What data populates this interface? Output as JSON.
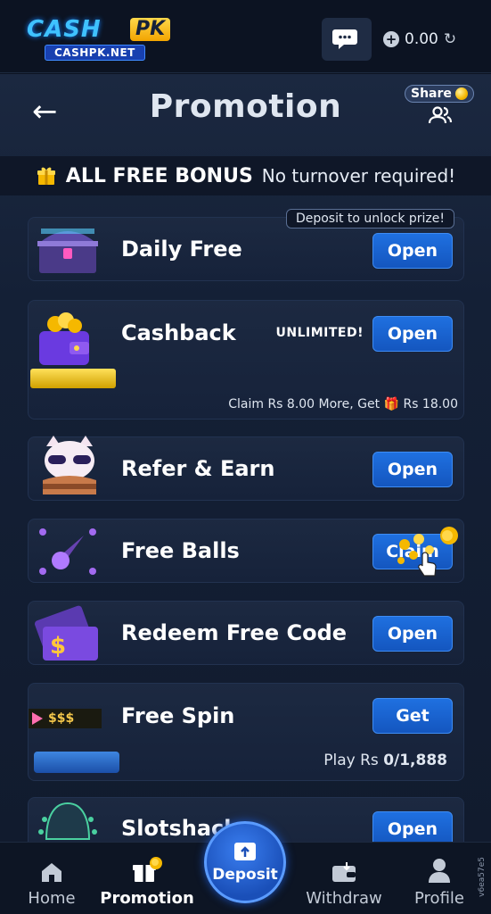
{
  "topbar": {
    "logo_main": "CASH",
    "logo_pk": "PK",
    "logo_sub": "CASHPK.NET",
    "balance": "0.00"
  },
  "header": {
    "title": "Promotion",
    "share_label": "Share"
  },
  "bonus_bar": {
    "strong": "ALL FREE BONUS",
    "weak": "No turnover required!"
  },
  "cards": {
    "daily": {
      "title": "Daily Free",
      "note": "Deposit to unlock prize!",
      "button": "Open"
    },
    "cashback": {
      "title": "Cashback",
      "badge": "UNLIMITED!",
      "button": "Open",
      "claim_text": "Claim Rs 8.00 More, Get",
      "claim_reward": "Rs 18.00"
    },
    "refer": {
      "title": "Refer & Earn",
      "button": "Open"
    },
    "balls": {
      "title": "Free Balls",
      "button": "Claim"
    },
    "redeem": {
      "title": "Redeem Free Code",
      "button": "Open"
    },
    "spin": {
      "title": "Free Spin",
      "button": "Get",
      "tag": "$$$",
      "play_label": "Play Rs",
      "play_value": "0/1,888"
    },
    "slotshack": {
      "title": "Slotshack",
      "button": "Open"
    }
  },
  "nav": {
    "home": "Home",
    "promotion": "Promotion",
    "deposit": "Deposit",
    "withdraw": "Withdraw",
    "profile": "Profile",
    "active": "promotion"
  },
  "watermark": "v6ea57e5",
  "colors": {
    "accent_blue": "#1f70e0",
    "background": "#0c1322",
    "gold": "#f5b800"
  }
}
